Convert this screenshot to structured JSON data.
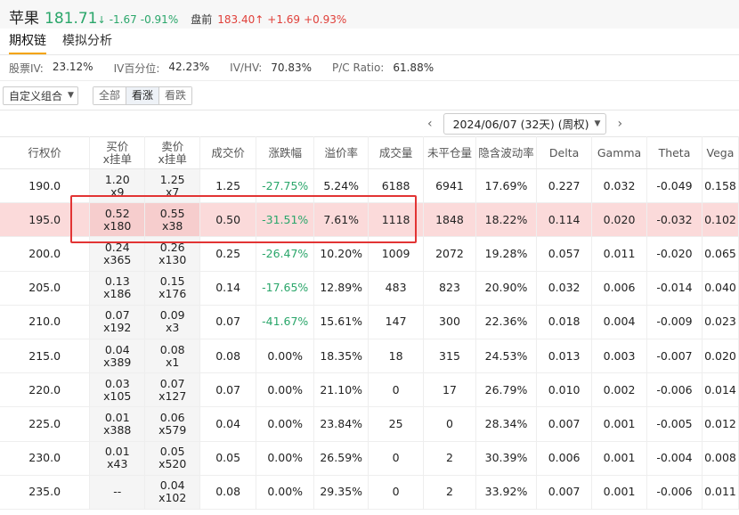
{
  "header": {
    "name": "苹果",
    "price": "181.71",
    "arrow": "↓",
    "change": "-1.67",
    "change_pct": "-0.91%",
    "premarket_label": "盘前",
    "premarket_price": "183.40↑",
    "premarket_change": "+1.69",
    "premarket_change_pct": "+0.93%"
  },
  "tabs": [
    {
      "label": "期权链",
      "active": true
    },
    {
      "label": "模拟分析",
      "active": false
    }
  ],
  "stats": [
    {
      "label": "股票IV:",
      "value": "23.12%"
    },
    {
      "label": "IV百分位:",
      "value": "42.23%"
    },
    {
      "label": "IV/HV:",
      "value": "70.83%"
    },
    {
      "label": "P/C Ratio:",
      "value": "61.88%"
    }
  ],
  "controls": {
    "combo_label": "自定义组合",
    "segments": [
      {
        "label": "全部",
        "active": false
      },
      {
        "label": "看涨",
        "active": true
      },
      {
        "label": "看跌",
        "active": false
      }
    ]
  },
  "expiry": {
    "prev": "‹",
    "date": "2024/06/07 (32天) (周权)",
    "next": "›"
  },
  "columns": [
    "行权价",
    "买价\nx挂单",
    "卖价\nx挂单",
    "成交价",
    "涨跌幅",
    "溢价率",
    "成交量",
    "未平仓量",
    "隐含波动率",
    "Delta",
    "Gamma",
    "Theta",
    "Vega"
  ],
  "rows": [
    {
      "strike": "190.0",
      "bid": "1.20",
      "bid_size": "x9",
      "ask": "1.25",
      "ask_size": "x7",
      "last": "1.25",
      "chg": "-27.75%",
      "chg_color": "green",
      "premium": "5.24%",
      "volume": "6188",
      "oi": "6941",
      "iv": "17.69%",
      "delta": "0.227",
      "gamma": "0.032",
      "theta": "-0.049",
      "vega": "0.158",
      "highlight": false
    },
    {
      "strike": "195.0",
      "bid": "0.52",
      "bid_size": "x180",
      "ask": "0.55",
      "ask_size": "x38",
      "last": "0.50",
      "chg": "-31.51%",
      "chg_color": "green",
      "premium": "7.61%",
      "volume": "1118",
      "oi": "1848",
      "iv": "18.22%",
      "delta": "0.114",
      "gamma": "0.020",
      "theta": "-0.032",
      "vega": "0.102",
      "highlight": true
    },
    {
      "strike": "200.0",
      "bid": "0.24",
      "bid_size": "x365",
      "ask": "0.26",
      "ask_size": "x130",
      "last": "0.25",
      "chg": "-26.47%",
      "chg_color": "green",
      "premium": "10.20%",
      "volume": "1009",
      "oi": "2072",
      "iv": "19.28%",
      "delta": "0.057",
      "gamma": "0.011",
      "theta": "-0.020",
      "vega": "0.065",
      "highlight": false
    },
    {
      "strike": "205.0",
      "bid": "0.13",
      "bid_size": "x186",
      "ask": "0.15",
      "ask_size": "x176",
      "last": "0.14",
      "chg": "-17.65%",
      "chg_color": "green",
      "premium": "12.89%",
      "volume": "483",
      "oi": "823",
      "iv": "20.90%",
      "delta": "0.032",
      "gamma": "0.006",
      "theta": "-0.014",
      "vega": "0.040",
      "highlight": false
    },
    {
      "strike": "210.0",
      "bid": "0.07",
      "bid_size": "x192",
      "ask": "0.09",
      "ask_size": "x3",
      "last": "0.07",
      "chg": "-41.67%",
      "chg_color": "green",
      "premium": "15.61%",
      "volume": "147",
      "oi": "300",
      "iv": "22.36%",
      "delta": "0.018",
      "gamma": "0.004",
      "theta": "-0.009",
      "vega": "0.023",
      "highlight": false
    },
    {
      "strike": "215.0",
      "bid": "0.04",
      "bid_size": "x389",
      "ask": "0.08",
      "ask_size": "x1",
      "last": "0.08",
      "chg": "0.00%",
      "chg_color": "neutral",
      "premium": "18.35%",
      "volume": "18",
      "oi": "315",
      "iv": "24.53%",
      "delta": "0.013",
      "gamma": "0.003",
      "theta": "-0.007",
      "vega": "0.020",
      "highlight": false
    },
    {
      "strike": "220.0",
      "bid": "0.03",
      "bid_size": "x105",
      "ask": "0.07",
      "ask_size": "x127",
      "last": "0.07",
      "chg": "0.00%",
      "chg_color": "neutral",
      "premium": "21.10%",
      "volume": "0",
      "oi": "17",
      "iv": "26.79%",
      "delta": "0.010",
      "gamma": "0.002",
      "theta": "-0.006",
      "vega": "0.014",
      "highlight": false
    },
    {
      "strike": "225.0",
      "bid": "0.01",
      "bid_size": "x388",
      "ask": "0.06",
      "ask_size": "x579",
      "last": "0.04",
      "chg": "0.00%",
      "chg_color": "neutral",
      "premium": "23.84%",
      "volume": "25",
      "oi": "0",
      "iv": "28.34%",
      "delta": "0.007",
      "gamma": "0.001",
      "theta": "-0.005",
      "vega": "0.012",
      "highlight": false
    },
    {
      "strike": "230.0",
      "bid": "0.01",
      "bid_size": "x43",
      "ask": "0.05",
      "ask_size": "x520",
      "last": "0.05",
      "chg": "0.00%",
      "chg_color": "neutral",
      "premium": "26.59%",
      "volume": "0",
      "oi": "2",
      "iv": "30.39%",
      "delta": "0.006",
      "gamma": "0.001",
      "theta": "-0.004",
      "vega": "0.008",
      "highlight": false
    },
    {
      "strike": "235.0",
      "bid": "--",
      "bid_size": "",
      "ask": "0.04",
      "ask_size": "x102",
      "last": "0.08",
      "chg": "0.00%",
      "chg_color": "neutral",
      "premium": "29.35%",
      "volume": "0",
      "oi": "2",
      "iv": "33.92%",
      "delta": "0.007",
      "gamma": "0.001",
      "theta": "-0.006",
      "vega": "0.011",
      "highlight": false
    }
  ],
  "colors": {
    "up": "#e0403a",
    "down": "#2aa66a",
    "highlight_row": "#fbdada",
    "annotation_box": "#e23434"
  }
}
